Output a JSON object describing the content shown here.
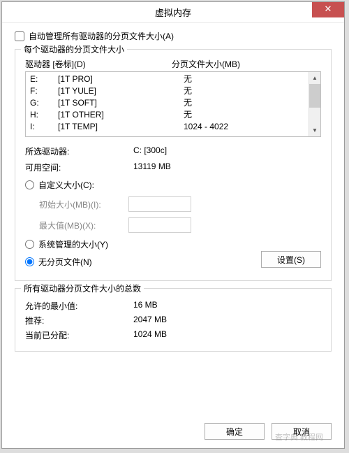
{
  "window_title": "虚拟内存",
  "auto_manage_label": "自动管理所有驱动器的分页文件大小(A)",
  "auto_manage_checked": false,
  "group1_title": "每个驱动器的分页文件大小",
  "col_drive": "驱动器 [卷标](D)",
  "col_size": "分页文件大小(MB)",
  "drives": [
    {
      "letter": "E:",
      "label": "[1T PRO]",
      "paging": "无"
    },
    {
      "letter": "F:",
      "label": "[1T YULE]",
      "paging": "无"
    },
    {
      "letter": "G:",
      "label": "[1T SOFT]",
      "paging": "无"
    },
    {
      "letter": "H:",
      "label": "[1T OTHER]",
      "paging": "无"
    },
    {
      "letter": "I:",
      "label": "[1T TEMP]",
      "paging": "1024 - 4022"
    }
  ],
  "selected_drive_label": "所选驱动器:",
  "selected_drive_value": "C:  [300c]",
  "free_space_label": "可用空间:",
  "free_space_value": "13119 MB",
  "radio_custom": "自定义大小(C):",
  "initial_size_label": "初始大小(MB)(I):",
  "max_size_label": "最大值(MB)(X):",
  "radio_system": "系统管理的大小(Y)",
  "radio_none": "无分页文件(N)",
  "selected_radio": "none",
  "set_button": "设置(S)",
  "group2_title": "所有驱动器分页文件大小的总数",
  "totals": {
    "min_label": "允许的最小值:",
    "min_value": "16 MB",
    "rec_label": "推荐:",
    "rec_value": "2047 MB",
    "cur_label": "当前已分配:",
    "cur_value": "1024 MB"
  },
  "ok_button": "确定",
  "cancel_button": "取消",
  "watermark": "查字典 教程网"
}
